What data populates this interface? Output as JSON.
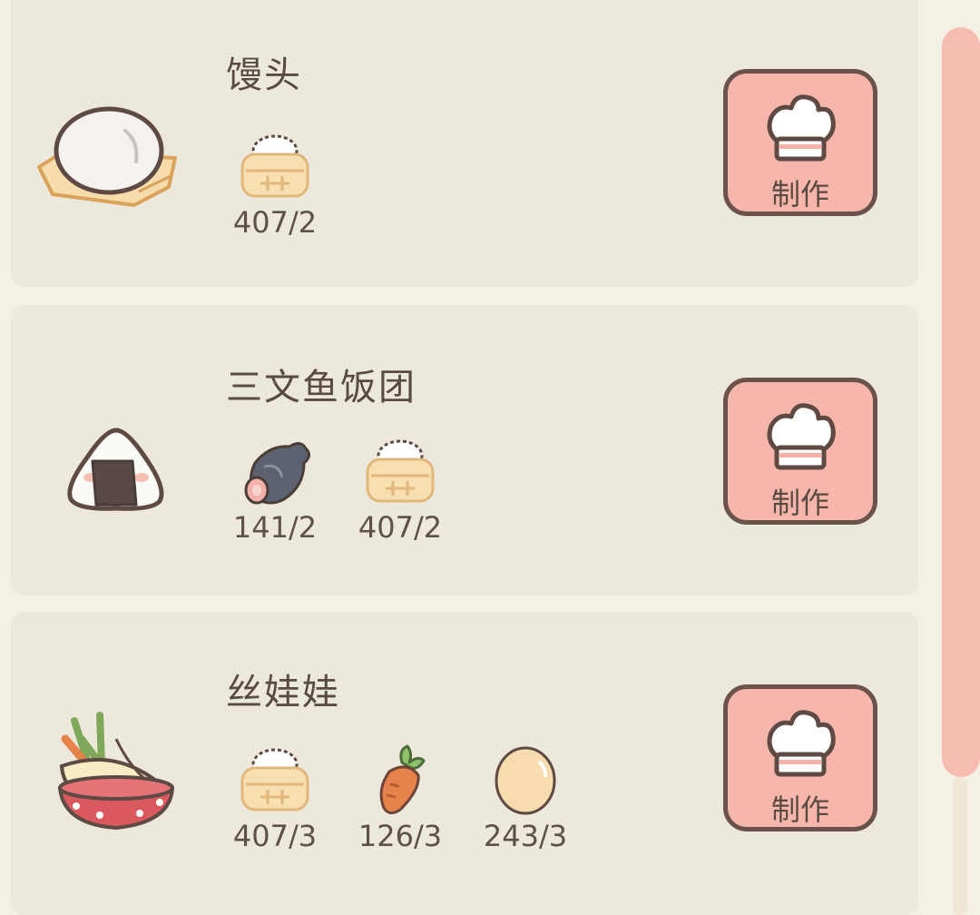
{
  "recipes": [
    {
      "name": "馒头",
      "dish_icon": "steamed-bun-icon",
      "ingredients": [
        {
          "icon": "rice-basket-icon",
          "count": "407/2"
        }
      ],
      "button_label": "制作",
      "button_icon": "chef-hat-icon"
    },
    {
      "name": "三文鱼饭团",
      "dish_icon": "salmon-onigiri-icon",
      "ingredients": [
        {
          "icon": "salmon-icon",
          "count": "141/2"
        },
        {
          "icon": "rice-basket-icon",
          "count": "407/2"
        }
      ],
      "button_label": "制作",
      "button_icon": "chef-hat-icon"
    },
    {
      "name": "丝娃娃",
      "dish_icon": "spring-roll-bowl-icon",
      "ingredients": [
        {
          "icon": "rice-basket-icon",
          "count": "407/3"
        },
        {
          "icon": "carrot-icon",
          "count": "126/3"
        },
        {
          "icon": "egg-icon",
          "count": "243/3"
        }
      ],
      "button_label": "制作",
      "button_icon": "chef-hat-icon"
    }
  ],
  "colors": {
    "background": "#f5f0e6",
    "card": "#ede8dc",
    "button": "#f7b6ab",
    "button_border": "#6b524a",
    "scrollbar": "#f7bcb1",
    "text": "#5e5148"
  }
}
